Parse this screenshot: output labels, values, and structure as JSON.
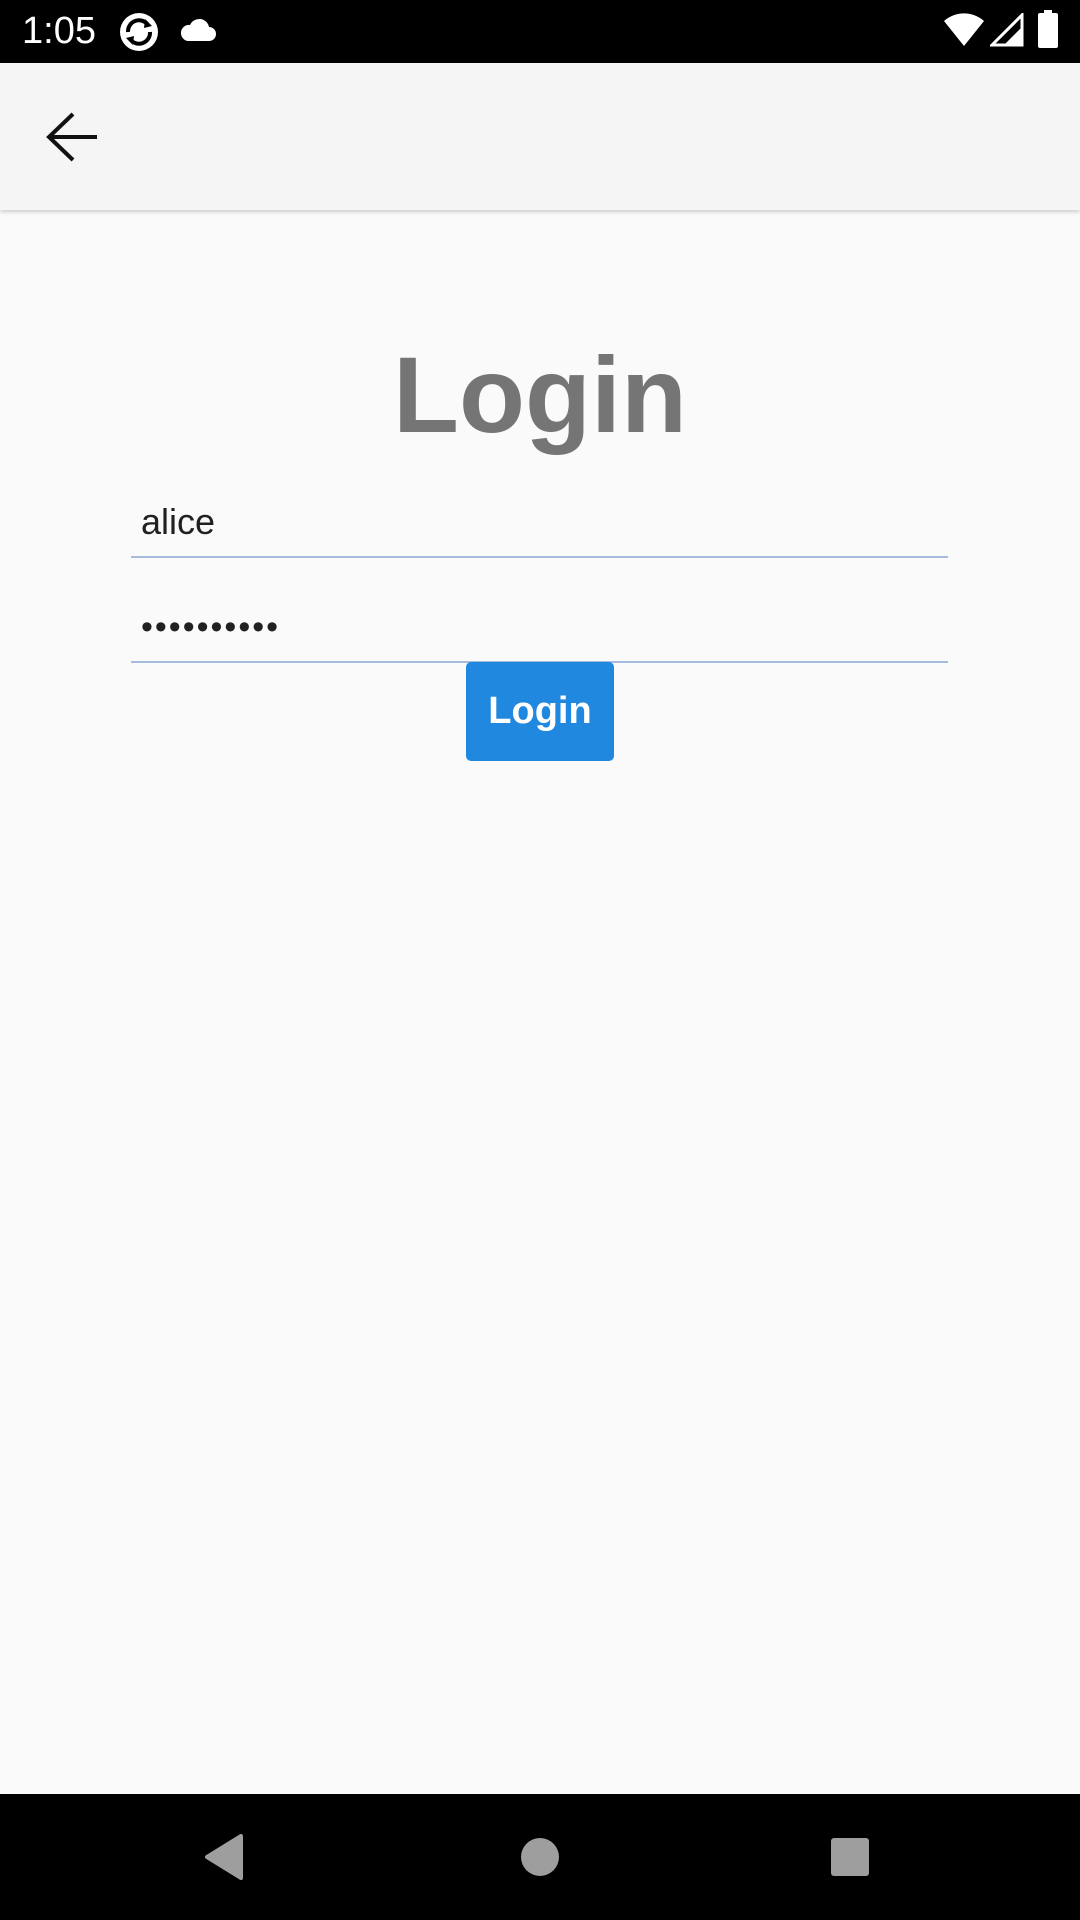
{
  "status_bar": {
    "time": "1:05",
    "icons": [
      "sync-icon",
      "cloud-icon",
      "wifi-icon",
      "signal-icon",
      "battery-icon"
    ]
  },
  "app_bar": {
    "back_icon": "back-arrow-icon"
  },
  "login_form": {
    "title": "Login",
    "username_value": "alice",
    "password_value": "••••••••••",
    "submit_label": "Login"
  },
  "nav_bar": {
    "icons": [
      "back-triangle-icon",
      "home-circle-icon",
      "recents-square-icon"
    ]
  },
  "colors": {
    "accent": "#2088de",
    "title": "#757575",
    "underline": "#a7bcdc",
    "app_bar": "#f5f5f5",
    "background": "#fafafa"
  }
}
